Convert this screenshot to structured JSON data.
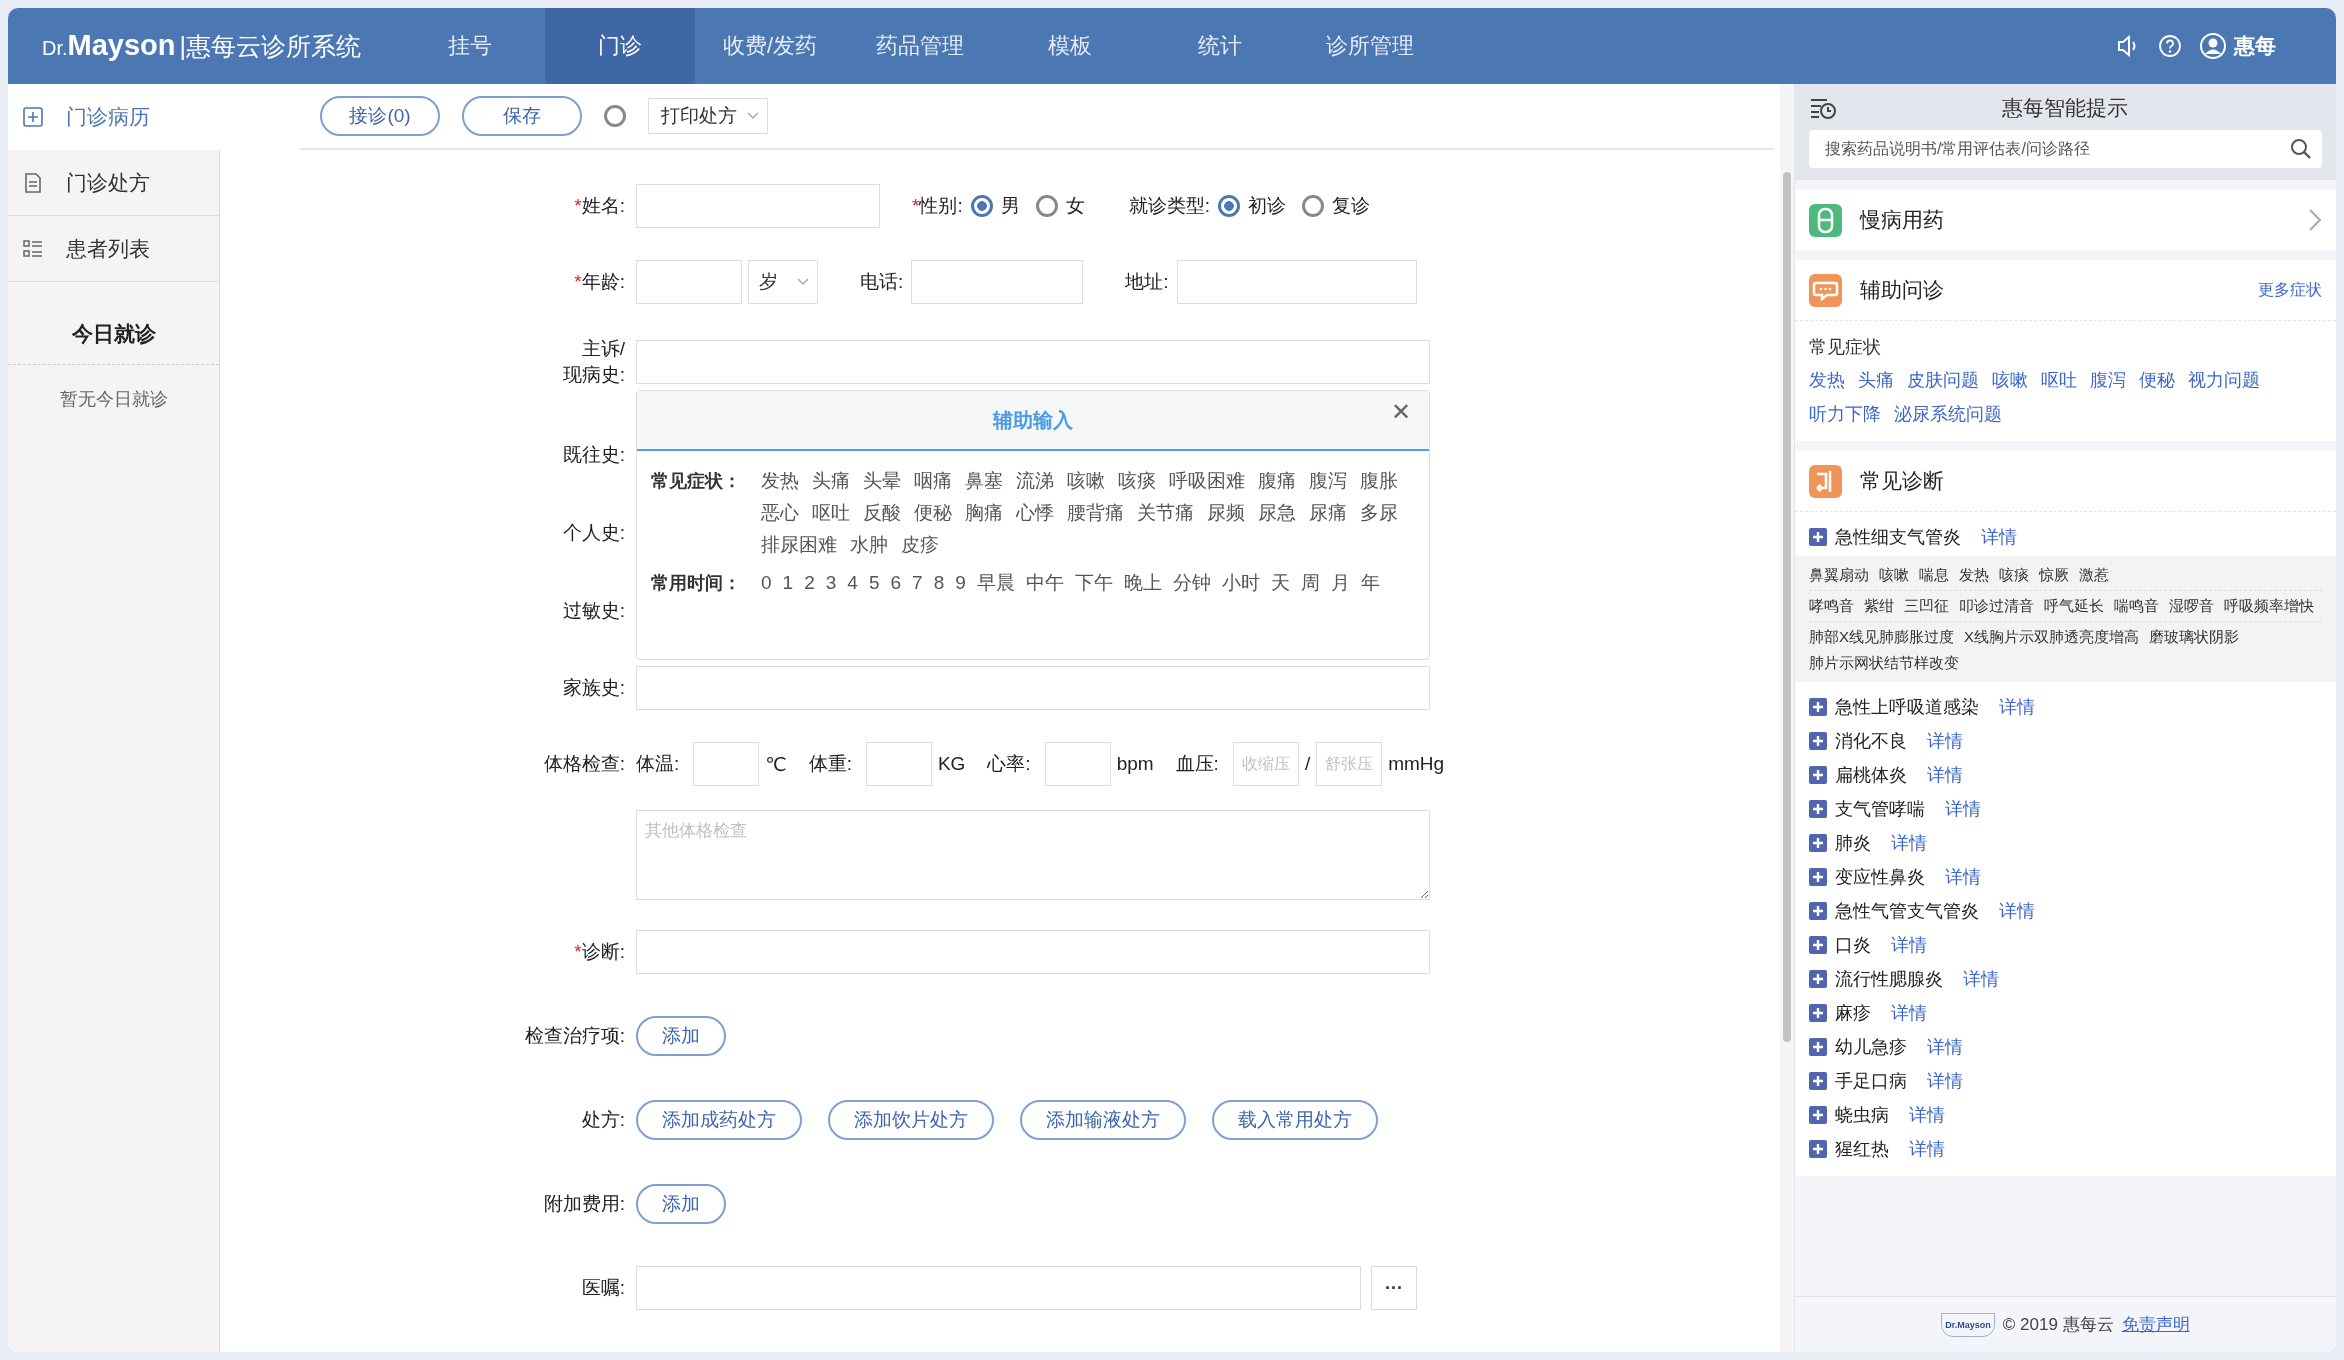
{
  "header": {
    "logo_prefix": "Dr.",
    "logo_brand": "Mayson",
    "system_name": "|惠每云诊所系统",
    "nav": [
      {
        "label": "挂号",
        "selected": false
      },
      {
        "label": "门诊",
        "selected": true
      },
      {
        "label": "收费/发药",
        "selected": false
      },
      {
        "label": "药品管理",
        "selected": false
      },
      {
        "label": "模板",
        "selected": false
      },
      {
        "label": "统计",
        "selected": false
      },
      {
        "label": "诊所管理",
        "selected": false
      }
    ],
    "user": "惠每"
  },
  "sidebar": {
    "items": [
      {
        "label": "门诊病历",
        "kind": "plus",
        "selected": true
      },
      {
        "label": "门诊处方",
        "kind": "doc",
        "selected": false
      },
      {
        "label": "患者列表",
        "kind": "list",
        "selected": false
      }
    ],
    "today_title": "今日就诊",
    "today_empty": "暂无今日就诊"
  },
  "toolbar": {
    "buttons": [
      "接诊(0)",
      "保存"
    ],
    "print_checked": false,
    "print_select": "打印处方"
  },
  "patient": {
    "name": {
      "required_mark": "*",
      "label": "姓名:"
    },
    "gender": {
      "required_mark": "*",
      "label": "性别:",
      "options": [
        {
          "label": "男",
          "selected": true
        },
        {
          "label": "女",
          "selected": false
        }
      ]
    },
    "visit_type": {
      "label": "就诊类型:",
      "options": [
        {
          "label": "初诊",
          "selected": true
        },
        {
          "label": "复诊",
          "selected": false
        }
      ]
    },
    "age": {
      "required_mark": "*",
      "label": "年龄:",
      "unit": "岁"
    },
    "phone": {
      "label": "电话:"
    },
    "address": {
      "label": "地址:"
    }
  },
  "history": {
    "complaint_label": "主诉/\n现病史:",
    "covered_labels": [
      "既往史:",
      "个人史:",
      "过敏史:"
    ],
    "family_label": "家族史:"
  },
  "assist_popup": {
    "title": "辅助输入",
    "close": "✕",
    "groups": [
      {
        "label": "常见症状：",
        "items": [
          "发热",
          "头痛",
          "头晕",
          "咽痛",
          "鼻塞",
          "流涕",
          "咳嗽",
          "咳痰",
          "呼吸困难",
          "腹痛",
          "腹泻",
          "腹胀",
          "恶心",
          "呕吐",
          "反酸",
          "便秘",
          "胸痛",
          "心悸",
          "腰背痛",
          "关节痛",
          "尿频",
          "尿急",
          "尿痛",
          "多尿",
          "排尿困难",
          "水肿",
          "皮疹"
        ]
      },
      {
        "label": "常用时间：",
        "items": [
          "0",
          "1",
          "2",
          "3",
          "4",
          "5",
          "6",
          "7",
          "8",
          "9",
          "早晨",
          "中午",
          "下午",
          "晚上",
          "分钟",
          "小时",
          "天",
          "周",
          "月",
          "年"
        ]
      }
    ]
  },
  "exam": {
    "label": "体格检查:",
    "vitals": [
      {
        "label": "体温:",
        "unit": "℃"
      },
      {
        "label": "体重:",
        "unit": "KG"
      },
      {
        "label": "心率:",
        "unit": "bpm"
      }
    ],
    "bp": {
      "label": "血压:",
      "systolic_placeholder": "收缩压",
      "separator": "/",
      "diastolic_placeholder": "舒张压",
      "unit": "mmHg"
    },
    "other_placeholder": "其他体格检查"
  },
  "diagnosis": {
    "required_mark": "*",
    "label": "诊断:"
  },
  "actions": [
    {
      "label": "检查治疗项:",
      "buttons": [
        "添加"
      ]
    },
    {
      "label": "处方:",
      "buttons": [
        "添加成药处方",
        "添加饮片处方",
        "添加输液处方",
        "载入常用处方"
      ]
    },
    {
      "label": "附加费用:",
      "buttons": [
        "添加"
      ]
    }
  ],
  "advice": {
    "label": "医嘱:",
    "more": "···"
  },
  "assistant": {
    "title": "惠每智能提示",
    "search_placeholder": "搜索药品说明书/常用评估表/问诊路径",
    "sections": [
      {
        "kind": "link",
        "title": "慢病用药",
        "color": "#4cba7c"
      },
      {
        "kind": "symptoms",
        "title": "辅助问诊",
        "color": "#f0945a",
        "more": "更多症状",
        "subtitle": "常见症状",
        "links": [
          "发热",
          "头痛",
          "皮肤问题",
          "咳嗽",
          "呕吐",
          "腹泻",
          "便秘",
          "视力问题",
          "听力下降",
          "泌尿系统问题"
        ]
      },
      {
        "kind": "diagnoses",
        "title": "常见诊断",
        "color": "#f0945a",
        "items": [
          {
            "name": "急性细支气管炎",
            "detail": "详情",
            "groups": [
              [
                "鼻翼扇动",
                "咳嗽",
                "喘息",
                "发热",
                "咳痰",
                "惊厥",
                "激惹"
              ],
              [
                "哮鸣音",
                "紫绀",
                "三凹征",
                "叩诊过清音",
                "呼气延长",
                "喘鸣音",
                "湿啰音",
                "呼吸频率增快"
              ],
              [
                "肺部X线见肺膨胀过度",
                "X线胸片示双肺透亮度增高",
                "磨玻璃状阴影",
                "肺片示网状结节样改变"
              ]
            ]
          },
          {
            "name": "急性上呼吸道感染",
            "detail": "详情"
          },
          {
            "name": "消化不良",
            "detail": "详情"
          },
          {
            "name": "扁桃体炎",
            "detail": "详情"
          },
          {
            "name": "支气管哮喘",
            "detail": "详情"
          },
          {
            "name": "肺炎",
            "detail": "详情"
          },
          {
            "name": "变应性鼻炎",
            "detail": "详情"
          },
          {
            "name": "急性气管支气管炎",
            "detail": "详情"
          },
          {
            "name": "口炎",
            "detail": "详情"
          },
          {
            "name": "流行性腮腺炎",
            "detail": "详情"
          },
          {
            "name": "麻疹",
            "detail": "详情"
          },
          {
            "name": "幼儿急疹",
            "detail": "详情"
          },
          {
            "name": "手足口病",
            "detail": "详情"
          },
          {
            "name": "蛲虫病",
            "detail": "详情"
          },
          {
            "name": "猩红热",
            "detail": "详情"
          }
        ]
      }
    ],
    "footer": {
      "logo": "Dr.Mayson",
      "copyright": "© 2019 惠每云",
      "disclaimer": "免责声明"
    }
  }
}
